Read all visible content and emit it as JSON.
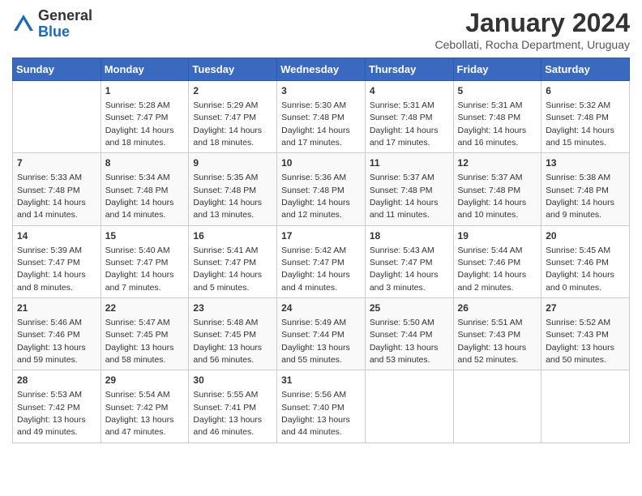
{
  "header": {
    "logo_general": "General",
    "logo_blue": "Blue",
    "title": "January 2024",
    "subtitle": "Cebollati, Rocha Department, Uruguay"
  },
  "days_of_week": [
    "Sunday",
    "Monday",
    "Tuesday",
    "Wednesday",
    "Thursday",
    "Friday",
    "Saturday"
  ],
  "weeks": [
    [
      {
        "day": "",
        "info": ""
      },
      {
        "day": "1",
        "info": "Sunrise: 5:28 AM\nSunset: 7:47 PM\nDaylight: 14 hours\nand 18 minutes."
      },
      {
        "day": "2",
        "info": "Sunrise: 5:29 AM\nSunset: 7:47 PM\nDaylight: 14 hours\nand 18 minutes."
      },
      {
        "day": "3",
        "info": "Sunrise: 5:30 AM\nSunset: 7:48 PM\nDaylight: 14 hours\nand 17 minutes."
      },
      {
        "day": "4",
        "info": "Sunrise: 5:31 AM\nSunset: 7:48 PM\nDaylight: 14 hours\nand 17 minutes."
      },
      {
        "day": "5",
        "info": "Sunrise: 5:31 AM\nSunset: 7:48 PM\nDaylight: 14 hours\nand 16 minutes."
      },
      {
        "day": "6",
        "info": "Sunrise: 5:32 AM\nSunset: 7:48 PM\nDaylight: 14 hours\nand 15 minutes."
      }
    ],
    [
      {
        "day": "7",
        "info": "Sunrise: 5:33 AM\nSunset: 7:48 PM\nDaylight: 14 hours\nand 14 minutes."
      },
      {
        "day": "8",
        "info": "Sunrise: 5:34 AM\nSunset: 7:48 PM\nDaylight: 14 hours\nand 14 minutes."
      },
      {
        "day": "9",
        "info": "Sunrise: 5:35 AM\nSunset: 7:48 PM\nDaylight: 14 hours\nand 13 minutes."
      },
      {
        "day": "10",
        "info": "Sunrise: 5:36 AM\nSunset: 7:48 PM\nDaylight: 14 hours\nand 12 minutes."
      },
      {
        "day": "11",
        "info": "Sunrise: 5:37 AM\nSunset: 7:48 PM\nDaylight: 14 hours\nand 11 minutes."
      },
      {
        "day": "12",
        "info": "Sunrise: 5:37 AM\nSunset: 7:48 PM\nDaylight: 14 hours\nand 10 minutes."
      },
      {
        "day": "13",
        "info": "Sunrise: 5:38 AM\nSunset: 7:48 PM\nDaylight: 14 hours\nand 9 minutes."
      }
    ],
    [
      {
        "day": "14",
        "info": "Sunrise: 5:39 AM\nSunset: 7:47 PM\nDaylight: 14 hours\nand 8 minutes."
      },
      {
        "day": "15",
        "info": "Sunrise: 5:40 AM\nSunset: 7:47 PM\nDaylight: 14 hours\nand 7 minutes."
      },
      {
        "day": "16",
        "info": "Sunrise: 5:41 AM\nSunset: 7:47 PM\nDaylight: 14 hours\nand 5 minutes."
      },
      {
        "day": "17",
        "info": "Sunrise: 5:42 AM\nSunset: 7:47 PM\nDaylight: 14 hours\nand 4 minutes."
      },
      {
        "day": "18",
        "info": "Sunrise: 5:43 AM\nSunset: 7:47 PM\nDaylight: 14 hours\nand 3 minutes."
      },
      {
        "day": "19",
        "info": "Sunrise: 5:44 AM\nSunset: 7:46 PM\nDaylight: 14 hours\nand 2 minutes."
      },
      {
        "day": "20",
        "info": "Sunrise: 5:45 AM\nSunset: 7:46 PM\nDaylight: 14 hours\nand 0 minutes."
      }
    ],
    [
      {
        "day": "21",
        "info": "Sunrise: 5:46 AM\nSunset: 7:46 PM\nDaylight: 13 hours\nand 59 minutes."
      },
      {
        "day": "22",
        "info": "Sunrise: 5:47 AM\nSunset: 7:45 PM\nDaylight: 13 hours\nand 58 minutes."
      },
      {
        "day": "23",
        "info": "Sunrise: 5:48 AM\nSunset: 7:45 PM\nDaylight: 13 hours\nand 56 minutes."
      },
      {
        "day": "24",
        "info": "Sunrise: 5:49 AM\nSunset: 7:44 PM\nDaylight: 13 hours\nand 55 minutes."
      },
      {
        "day": "25",
        "info": "Sunrise: 5:50 AM\nSunset: 7:44 PM\nDaylight: 13 hours\nand 53 minutes."
      },
      {
        "day": "26",
        "info": "Sunrise: 5:51 AM\nSunset: 7:43 PM\nDaylight: 13 hours\nand 52 minutes."
      },
      {
        "day": "27",
        "info": "Sunrise: 5:52 AM\nSunset: 7:43 PM\nDaylight: 13 hours\nand 50 minutes."
      }
    ],
    [
      {
        "day": "28",
        "info": "Sunrise: 5:53 AM\nSunset: 7:42 PM\nDaylight: 13 hours\nand 49 minutes."
      },
      {
        "day": "29",
        "info": "Sunrise: 5:54 AM\nSunset: 7:42 PM\nDaylight: 13 hours\nand 47 minutes."
      },
      {
        "day": "30",
        "info": "Sunrise: 5:55 AM\nSunset: 7:41 PM\nDaylight: 13 hours\nand 46 minutes."
      },
      {
        "day": "31",
        "info": "Sunrise: 5:56 AM\nSunset: 7:40 PM\nDaylight: 13 hours\nand 44 minutes."
      },
      {
        "day": "",
        "info": ""
      },
      {
        "day": "",
        "info": ""
      },
      {
        "day": "",
        "info": ""
      }
    ]
  ]
}
